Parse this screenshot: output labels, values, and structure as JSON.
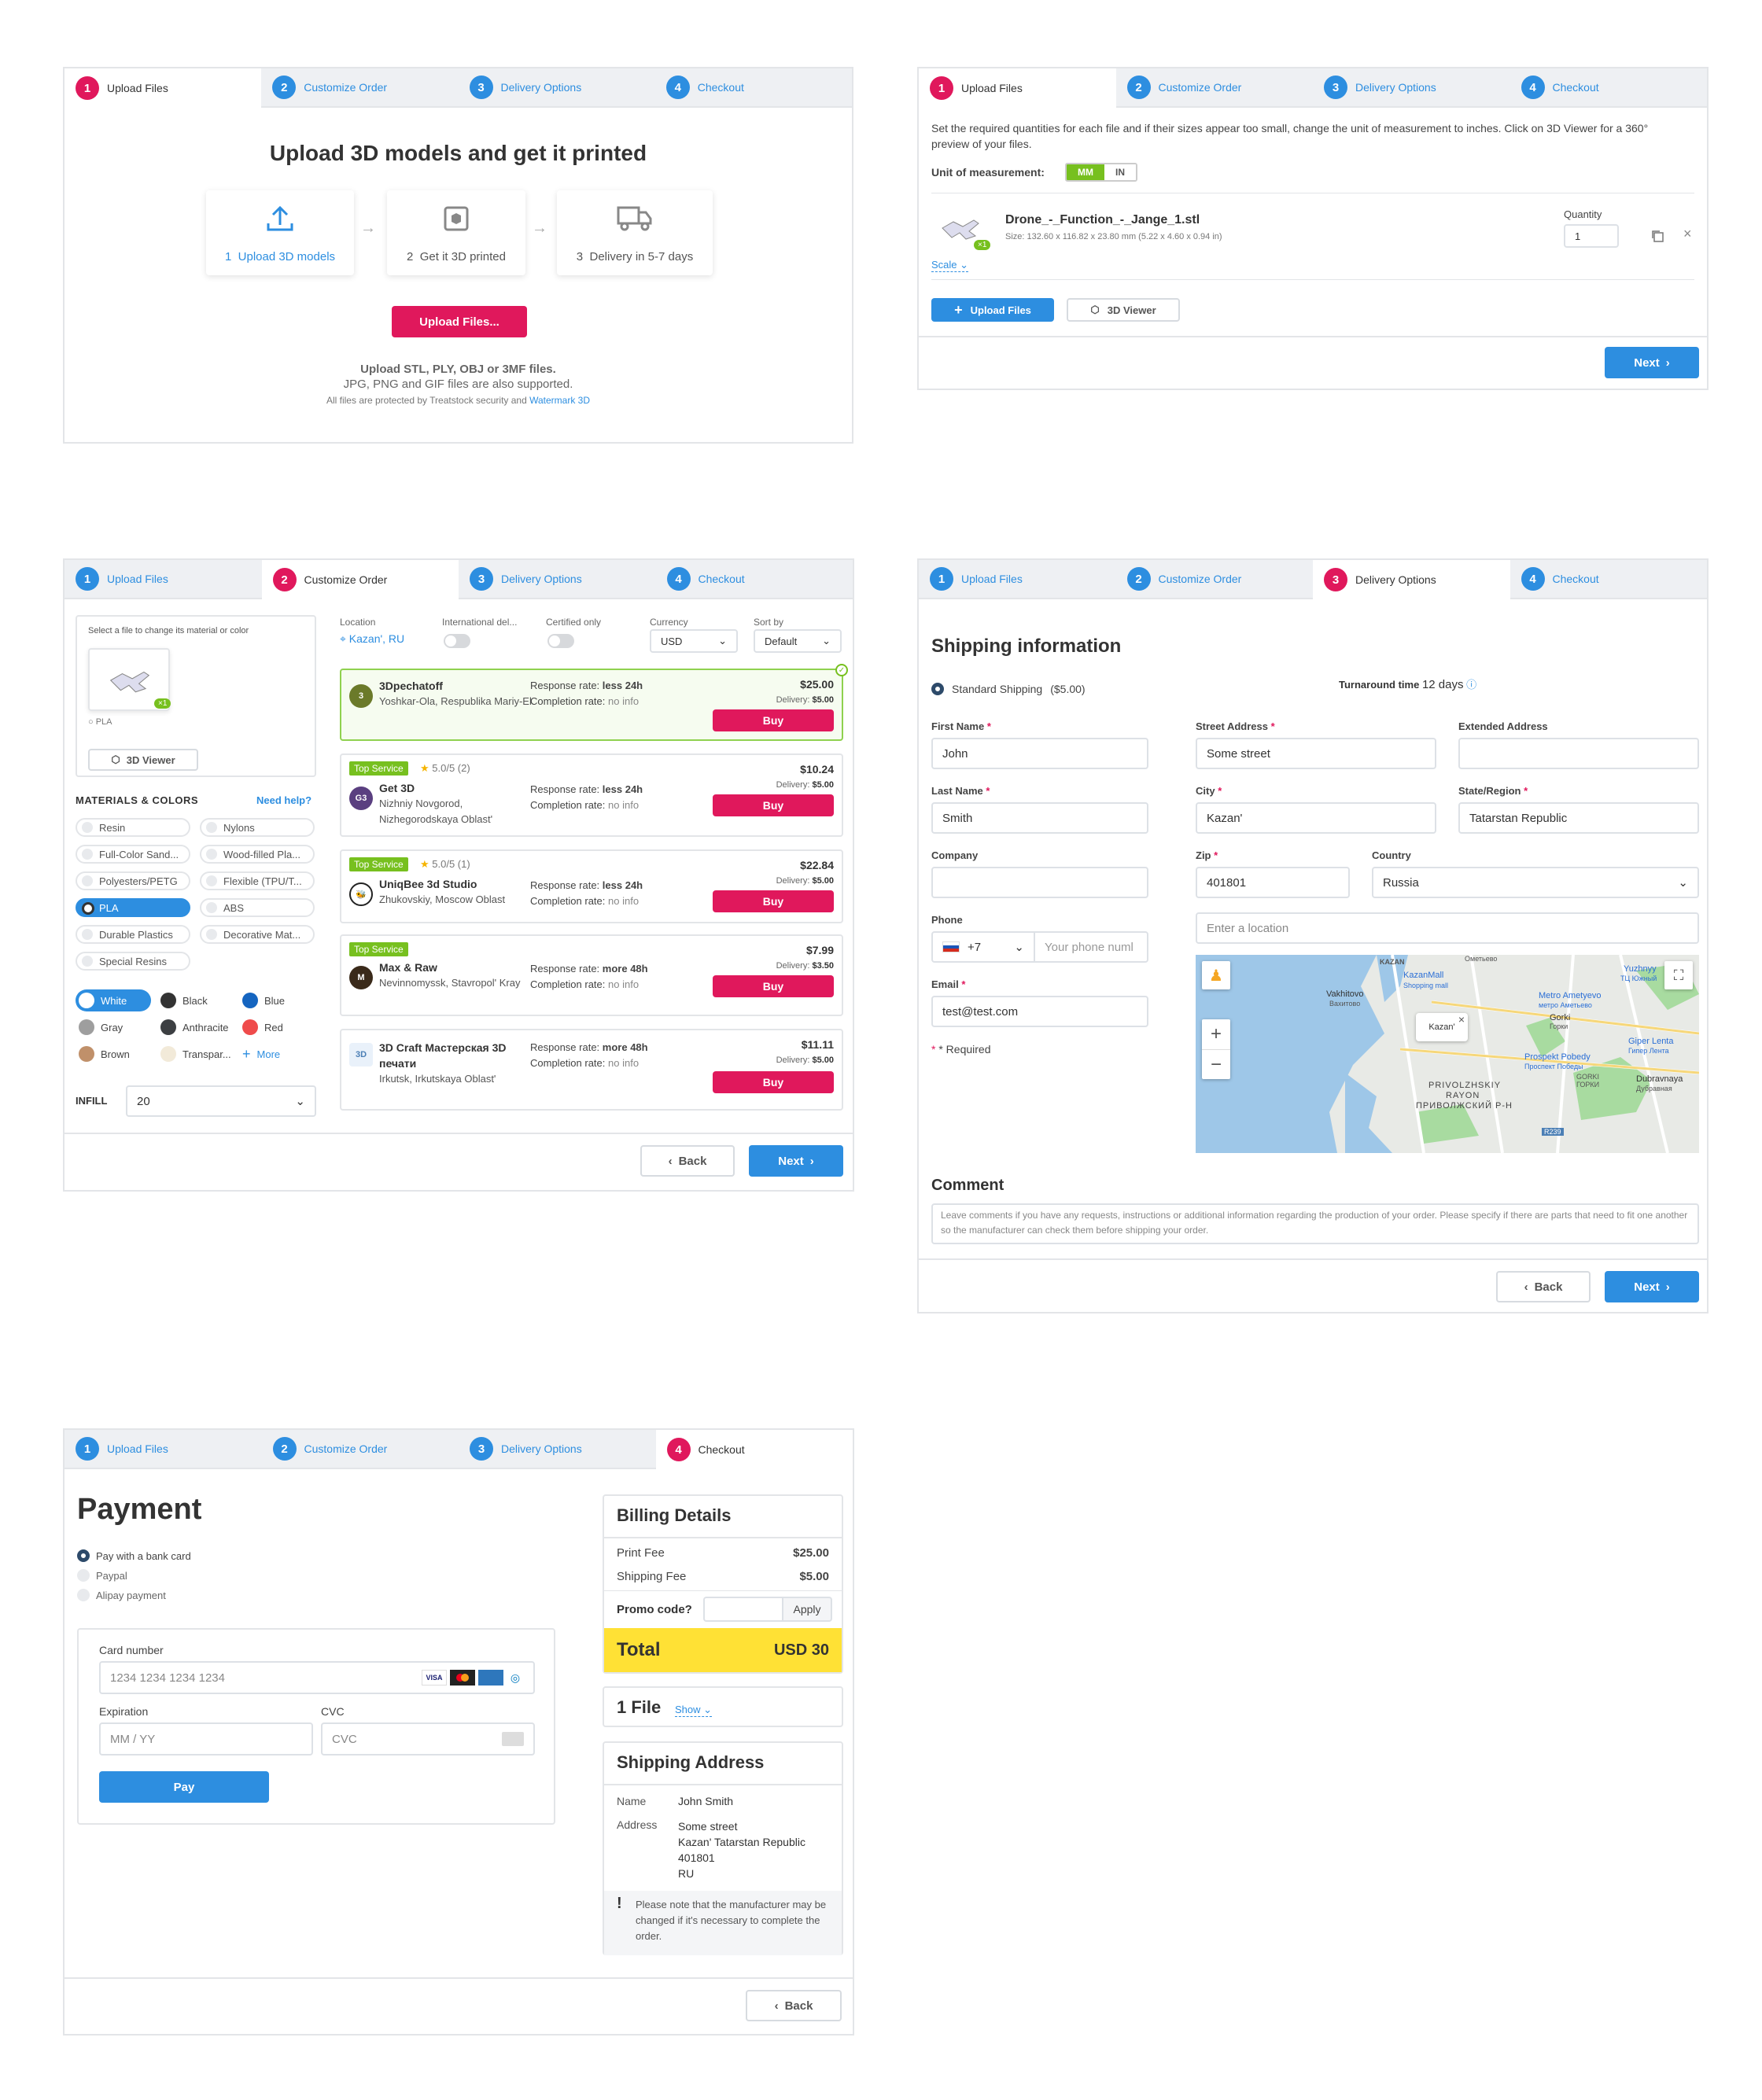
{
  "steps": {
    "s1": "Upload Files",
    "s2": "Customize Order",
    "s3": "Delivery Options",
    "s4": "Checkout",
    "n1": "1",
    "n2": "2",
    "n3": "3",
    "n4": "4"
  },
  "upload": {
    "heading": "Upload 3D models and get it printed",
    "steps": [
      {
        "num": "1",
        "label": "Upload 3D models"
      },
      {
        "num": "2",
        "label": "Get it 3D printed"
      },
      {
        "num": "3",
        "label": "Delivery in 5-7 days"
      }
    ],
    "button": "Upload Files...",
    "formats": "Upload STL, PLY, OBJ or 3MF files.",
    "formats2": "JPG, PNG and GIF files are also supported.",
    "protected": "All files are protected by Treatstock security and",
    "watermark": "Watermark 3D"
  },
  "files": {
    "intro": "Set the required quantities for each file and if their sizes appear too small, change the unit of measurement to inches. Click on 3D Viewer for a 360° preview of your files.",
    "unit_label": "Unit of measurement:",
    "unit_mm": "MM",
    "unit_in": "IN",
    "file_name": "Drone_-_Function_-_Jange_1.stl",
    "file_size": "Size: 132.60 x 116.82 x 23.80 mm (5.22 x 4.60 x 0.94 in)",
    "badge": "×1",
    "scale": "Scale",
    "qty_label": "Quantity",
    "qty": "1",
    "upload_btn": "Upload Files",
    "viewer_btn": "3D Viewer",
    "next": "Next"
  },
  "customize": {
    "select_hint": "Select a file to change its material or color",
    "badge": "×1",
    "material": "PLA",
    "viewer_btn": "3D Viewer",
    "materials_title": "MATERIALS & COLORS",
    "need_help": "Need help?",
    "materials": [
      "Resin",
      "Nylons",
      "Full-Color Sand...",
      "Wood-filled Pla...",
      "Polyesters/PETG",
      "Flexible (TPU/T...",
      "PLA",
      "ABS",
      "Durable Plastics",
      "Decorative Mat...",
      "Special Resins"
    ],
    "colors": [
      {
        "name": "White",
        "hex": "#ffffff"
      },
      {
        "name": "Black",
        "hex": "#333333"
      },
      {
        "name": "Blue",
        "hex": "#1565c0"
      },
      {
        "name": "Gray",
        "hex": "#9e9e9e"
      },
      {
        "name": "Anthracite",
        "hex": "#3c3f42"
      },
      {
        "name": "Red",
        "hex": "#ef4b4b"
      },
      {
        "name": "Brown",
        "hex": "#c0906a"
      },
      {
        "name": "Transpar...",
        "hex": "#f2ead9"
      }
    ],
    "more": "More",
    "infill_label": "INFILL",
    "infill": "20",
    "filters": {
      "location_label": "Location",
      "location": "Kazan', RU",
      "intl_label": "International del...",
      "cert_label": "Certified only",
      "currency_label": "Currency",
      "currency": "USD",
      "sort_label": "Sort by",
      "sort": "Default"
    },
    "manufacturers": [
      {
        "name": "3Dpechatoff",
        "loc": "Yoshkar-Ola, Respublika Mariy-El",
        "rr_label": "Response rate:",
        "rr": "less 24h",
        "cr_label": "Completion rate:",
        "cr": "no info",
        "price": "$25.00",
        "delivery_label": "Delivery:",
        "delivery": "$5.00",
        "buy": "Buy",
        "logo": "3",
        "logo_color": "#6b7a2a"
      },
      {
        "badge": "Top Service",
        "rating": "5.0/5 (2)",
        "name": "Get 3D",
        "loc": "Nizhniy Novgorod, Nizhegorodskaya Oblast'",
        "rr_label": "Response rate:",
        "rr": "less 24h",
        "cr_label": "Completion rate:",
        "cr": "no info",
        "price": "$10.24",
        "delivery_label": "Delivery:",
        "delivery": "$5.00",
        "buy": "Buy",
        "logo": "G3",
        "logo_color": "#5a3f80"
      },
      {
        "badge": "Top Service",
        "rating": "5.0/5 (1)",
        "name": "UniqBee 3d Studio",
        "loc": "Zhukovskiy, Moscow Oblast",
        "rr_label": "Response rate:",
        "rr": "less 24h",
        "cr_label": "Completion rate:",
        "cr": "no info",
        "price": "$22.84",
        "delivery_label": "Delivery:",
        "delivery": "$5.00",
        "buy": "Buy",
        "logo": "🐝",
        "logo_color": "#222222"
      },
      {
        "badge": "Top Service",
        "name": "Max & Raw",
        "loc": "Nevinnomyssk, Stavropol' Kray",
        "rr_label": "Response rate:",
        "rr": "more 48h",
        "cr_label": "Completion rate:",
        "cr": "no info",
        "price": "$7.99",
        "delivery_label": "Delivery:",
        "delivery": "$3.50",
        "buy": "Buy",
        "logo": "M",
        "logo_color": "#3a2a1a"
      },
      {
        "name": "3D Craft Мастерская 3D печати",
        "loc": "Irkutsk, Irkutskaya Oblast'",
        "rr_label": "Response rate:",
        "rr": "more 48h",
        "cr_label": "Completion rate:",
        "cr": "no info",
        "price": "$11.11",
        "delivery_label": "Delivery:",
        "delivery": "$5.00",
        "buy": "Buy",
        "logo": "3D",
        "logo_color": "#8fb3d9"
      }
    ],
    "back": "Back",
    "next": "Next"
  },
  "shipping": {
    "title": "Shipping information",
    "standard": "Standard Shipping",
    "standard_price": "($5.00)",
    "turnaround_label": "Turnaround time",
    "turnaround": "12 days",
    "first_name_label": "First Name",
    "first_name": "John",
    "last_name_label": "Last Name",
    "last_name": "Smith",
    "company_label": "Company",
    "phone_label": "Phone",
    "phone_code": "+7",
    "phone_placeholder": "Your phone numl",
    "email_label": "Email",
    "email": "test@test.com",
    "required": "* Required",
    "street_label": "Street Address",
    "street": "Some street",
    "ext_label": "Extended Address",
    "city_label": "City",
    "city": "Kazan'",
    "state_label": "State/Region",
    "state": "Tatarstan Republic",
    "zip_label": "Zip",
    "zip": "401801",
    "country_label": "Country",
    "country": "Russia",
    "location_placeholder": "Enter a location",
    "map_labels": {
      "kazan": "KAZAN",
      "kazanmall": "KazanMall",
      "shopping": "Shopping mall",
      "vakhitovo": "Vakhitovo",
      "vakhitovo_ru": "Вахитово",
      "pin": "Kazan'",
      "metro": "Metro Ametyevo",
      "metro_ru": "метро Аметьево",
      "gorki": "Gorki",
      "gorki_ru": "Горки",
      "yuzhnyy": "Yuzhnyy",
      "yuzhnyy_ru": "ТЦ Южный",
      "giper": "Giper Lenta",
      "giper_ru": "Гипер Лента",
      "prospekt": "Prospekt Pobedy",
      "prospekt_ru": "Проспект Победы",
      "gorki2": "GORKI",
      "gorki2_ru": "ГОРКИ",
      "dubrav": "Dubravnaya",
      "dubrav_ru": "Дубравная",
      "privol": "PRIVOLZHSKIY",
      "rayon": "RAYON",
      "privol_ru": "ПРИВОЛЖСКИЙ Р-Н",
      "road": "R239",
      "amet": "Ометьево"
    },
    "comment_title": "Comment",
    "comment_placeholder": "Leave comments if you have any requests, instructions or additional information regarding the production of your order. Please specify if there are parts that need to fit one another so the manufacturer can check them before shipping your order.",
    "back": "Back",
    "next": "Next"
  },
  "payment": {
    "title": "Payment",
    "opt1": "Pay with a bank card",
    "opt2": "Paypal",
    "opt3": "Alipay payment",
    "card_label": "Card number",
    "card_placeholder": "1234 1234 1234 1234",
    "exp_label": "Expiration",
    "exp_placeholder": "MM / YY",
    "cvc_label": "CVC",
    "cvc_placeholder": "CVC",
    "pay": "Pay",
    "billing_title": "Billing Details",
    "print_fee_label": "Print Fee",
    "print_fee": "$25.00",
    "shipping_fee_label": "Shipping Fee",
    "shipping_fee": "$5.00",
    "promo_label": "Promo code?",
    "apply": "Apply",
    "total_label": "Total",
    "total": "USD 30",
    "files_title": "1 File",
    "show": "Show",
    "ship_title": "Shipping Address",
    "name_label": "Name",
    "name": "John Smith",
    "address_label": "Address",
    "addr1": "Some street",
    "addr2": "Kazan' Tatarstan Republic",
    "addr3": "401801",
    "addr4": "RU",
    "note": "Please note that the manufacturer may be changed if it's necessary to complete the order.",
    "back": "Back"
  }
}
